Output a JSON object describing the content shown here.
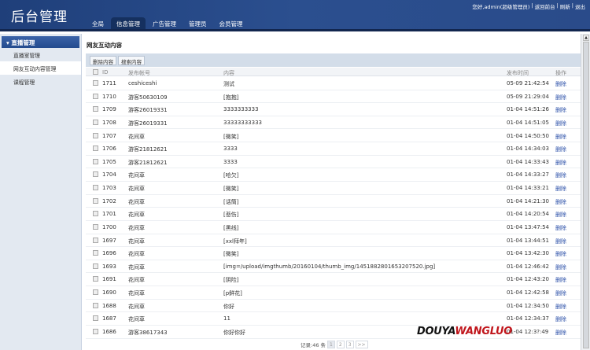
{
  "header": {
    "title": "后台管理",
    "nav": [
      "全局",
      "信息管理",
      "广告管理",
      "管理员",
      "会员管理"
    ],
    "active_nav": 1,
    "user": {
      "greeting": "您好,admin(超级管理员)",
      "sep": "|",
      "back": "返回前台",
      "refresh": "刷新",
      "logout": "退出"
    }
  },
  "sidebar": {
    "group": "直播管理",
    "items": [
      "直播室管理",
      "网友互动内容管理",
      "课程管理"
    ],
    "active": 1
  },
  "main": {
    "title": "网友互动内容",
    "buttons": {
      "delete": "删除内容",
      "search": "搜索内容"
    },
    "columns": {
      "id": "ID",
      "account": "发布帐号",
      "content": "内容",
      "time": "发布时间",
      "action": "操作"
    },
    "rows": [
      {
        "id": "1711",
        "account": "ceshiceshi",
        "content": "测试",
        "time": "05-09 21:42:54",
        "action": "删除"
      },
      {
        "id": "1710",
        "account": "游客50630109",
        "content": "[抱抱]",
        "time": "05-09 21:29:04",
        "action": "删除"
      },
      {
        "id": "1709",
        "account": "游客26019331",
        "content": "3333333333",
        "time": "01-04 14:51:26",
        "action": "删除"
      },
      {
        "id": "1708",
        "account": "游客26019331",
        "content": "33333333333",
        "time": "01-04 14:51:05",
        "action": "删除"
      },
      {
        "id": "1707",
        "account": "花间草",
        "content": "[微笑]",
        "time": "01-04 14:50:50",
        "action": "删除"
      },
      {
        "id": "1706",
        "account": "游客21812621",
        "content": "3333",
        "time": "01-04 14:34:03",
        "action": "删除"
      },
      {
        "id": "1705",
        "account": "游客21812621",
        "content": "3333",
        "time": "01-04 14:33:43",
        "action": "删除"
      },
      {
        "id": "1704",
        "account": "花间草",
        "content": "[哈欠]",
        "time": "01-04 14:33:27",
        "action": "删除"
      },
      {
        "id": "1703",
        "account": "花间草",
        "content": "[微笑]",
        "time": "01-04 14:33:21",
        "action": "删除"
      },
      {
        "id": "1702",
        "account": "花间草",
        "content": "[话筒]",
        "time": "01-04 14:21:30",
        "action": "删除"
      },
      {
        "id": "1701",
        "account": "花间草",
        "content": "[悲伤]",
        "time": "01-04 14:20:54",
        "action": "删除"
      },
      {
        "id": "1700",
        "account": "花间草",
        "content": "[黑线]",
        "time": "01-04 13:47:54",
        "action": "删除"
      },
      {
        "id": "1697",
        "account": "花间草",
        "content": "[xxl拜年]",
        "time": "01-04 13:44:51",
        "action": "删除"
      },
      {
        "id": "1696",
        "account": "花间草",
        "content": "[微笑]",
        "time": "01-04 13:42:30",
        "action": "删除"
      },
      {
        "id": "1693",
        "account": "花间草",
        "content": "[img=/upload/imgthumb/20160104/thumb_img/1451882801653207520.jpg]",
        "time": "01-04 12:46:42",
        "action": "删除"
      },
      {
        "id": "1691",
        "account": "花间草",
        "content": "[阴险]",
        "time": "01-04 12:43:20",
        "action": "删除"
      },
      {
        "id": "1690",
        "account": "花间草",
        "content": "[p鲜花]",
        "time": "01-04 12:42:58",
        "action": "删除"
      },
      {
        "id": "1688",
        "account": "花间草",
        "content": "你好",
        "time": "01-04 12:34:50",
        "action": "删除"
      },
      {
        "id": "1687",
        "account": "花间草",
        "content": "11",
        "time": "01-04 12:34:37",
        "action": "删除"
      },
      {
        "id": "1686",
        "account": "游客38617343",
        "content": "你好你好",
        "time": "01-04 12:3?:49",
        "action": "删除"
      }
    ],
    "pager": {
      "summary": "记录:46 条",
      "pages": [
        "1",
        "2",
        "3",
        ">>"
      ],
      "current": 0
    }
  },
  "watermark": {
    "part1": "DOUYA",
    "part2": "WANGLUO"
  }
}
